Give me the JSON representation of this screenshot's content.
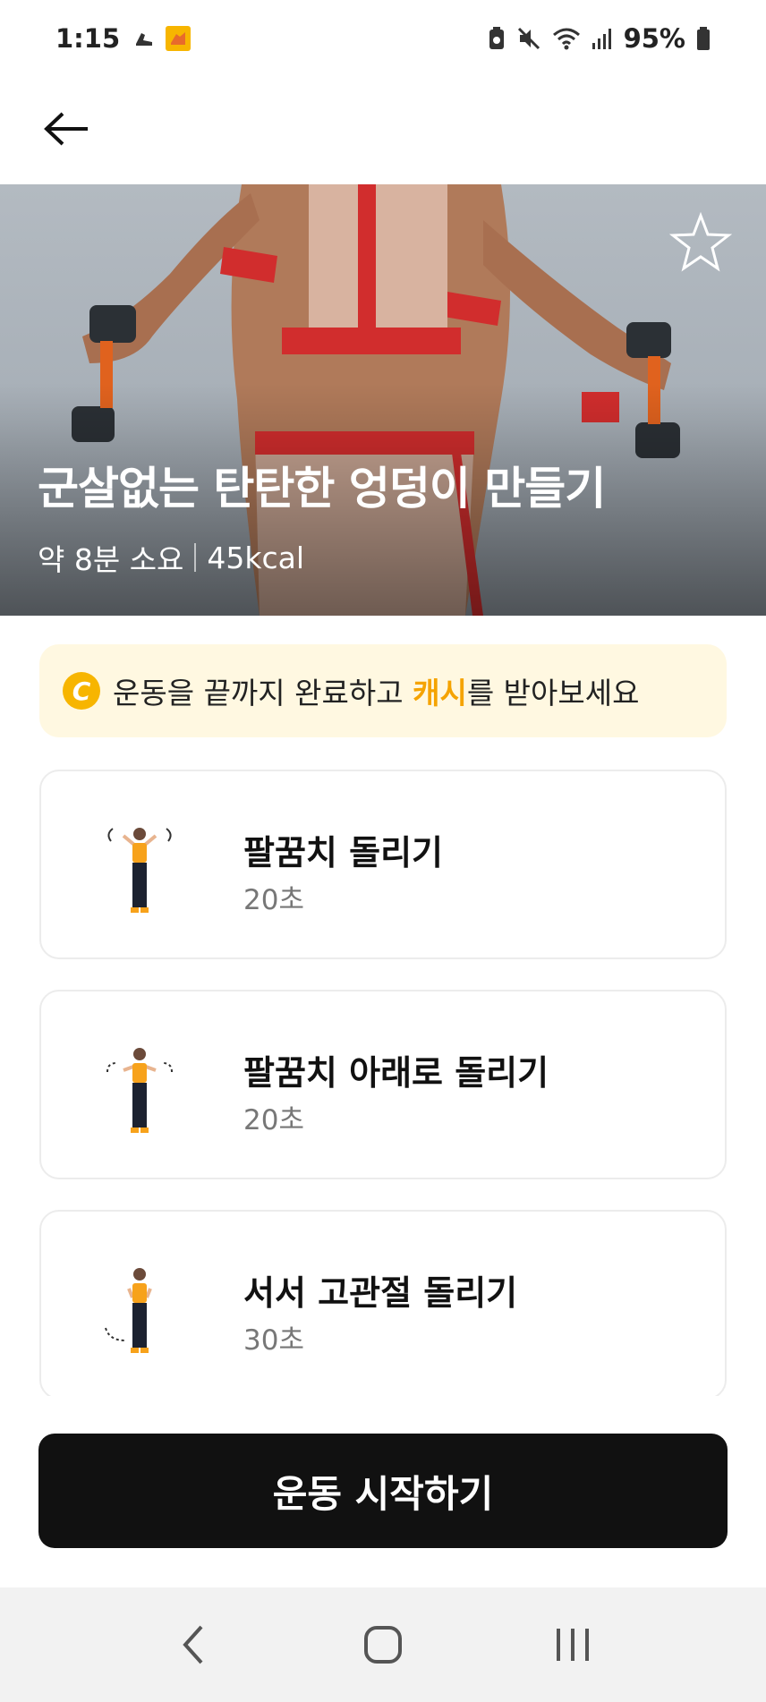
{
  "status_bar": {
    "time": "1:15",
    "battery": "95%",
    "icons": [
      "sneaker-notification-icon",
      "app-notification-icon",
      "battery-saver-icon",
      "mute-icon",
      "wifi-icon",
      "signal-icon",
      "battery-icon"
    ]
  },
  "header": {
    "back_icon": "arrow-left-icon"
  },
  "hero": {
    "title": "군살없는 탄탄한 엉덩이 만들기",
    "duration": "약 8분 소요",
    "calories": "45kcal",
    "favorite_icon": "star-outline-icon"
  },
  "cash_banner": {
    "coin_letter": "C",
    "text_before": "운동을 끝까지 완료하고 ",
    "highlight": "캐시",
    "text_after": "를 받아보세요",
    "highlight_color": "#f5a300"
  },
  "exercises": [
    {
      "name": "팔꿈치 돌리기",
      "duration": "20초"
    },
    {
      "name": "팔꿈치 아래로 돌리기",
      "duration": "20초"
    },
    {
      "name": "서서 고관절 돌리기",
      "duration": "30초"
    }
  ],
  "start_button": {
    "label": "운동 시작하기"
  },
  "nav_bar": {
    "back_icon": "nav-back-icon",
    "home_icon": "nav-home-icon",
    "recents_icon": "nav-recents-icon"
  },
  "colors": {
    "accent": "#f5a300",
    "button": "#111111",
    "banner_bg": "#fff8e1"
  }
}
